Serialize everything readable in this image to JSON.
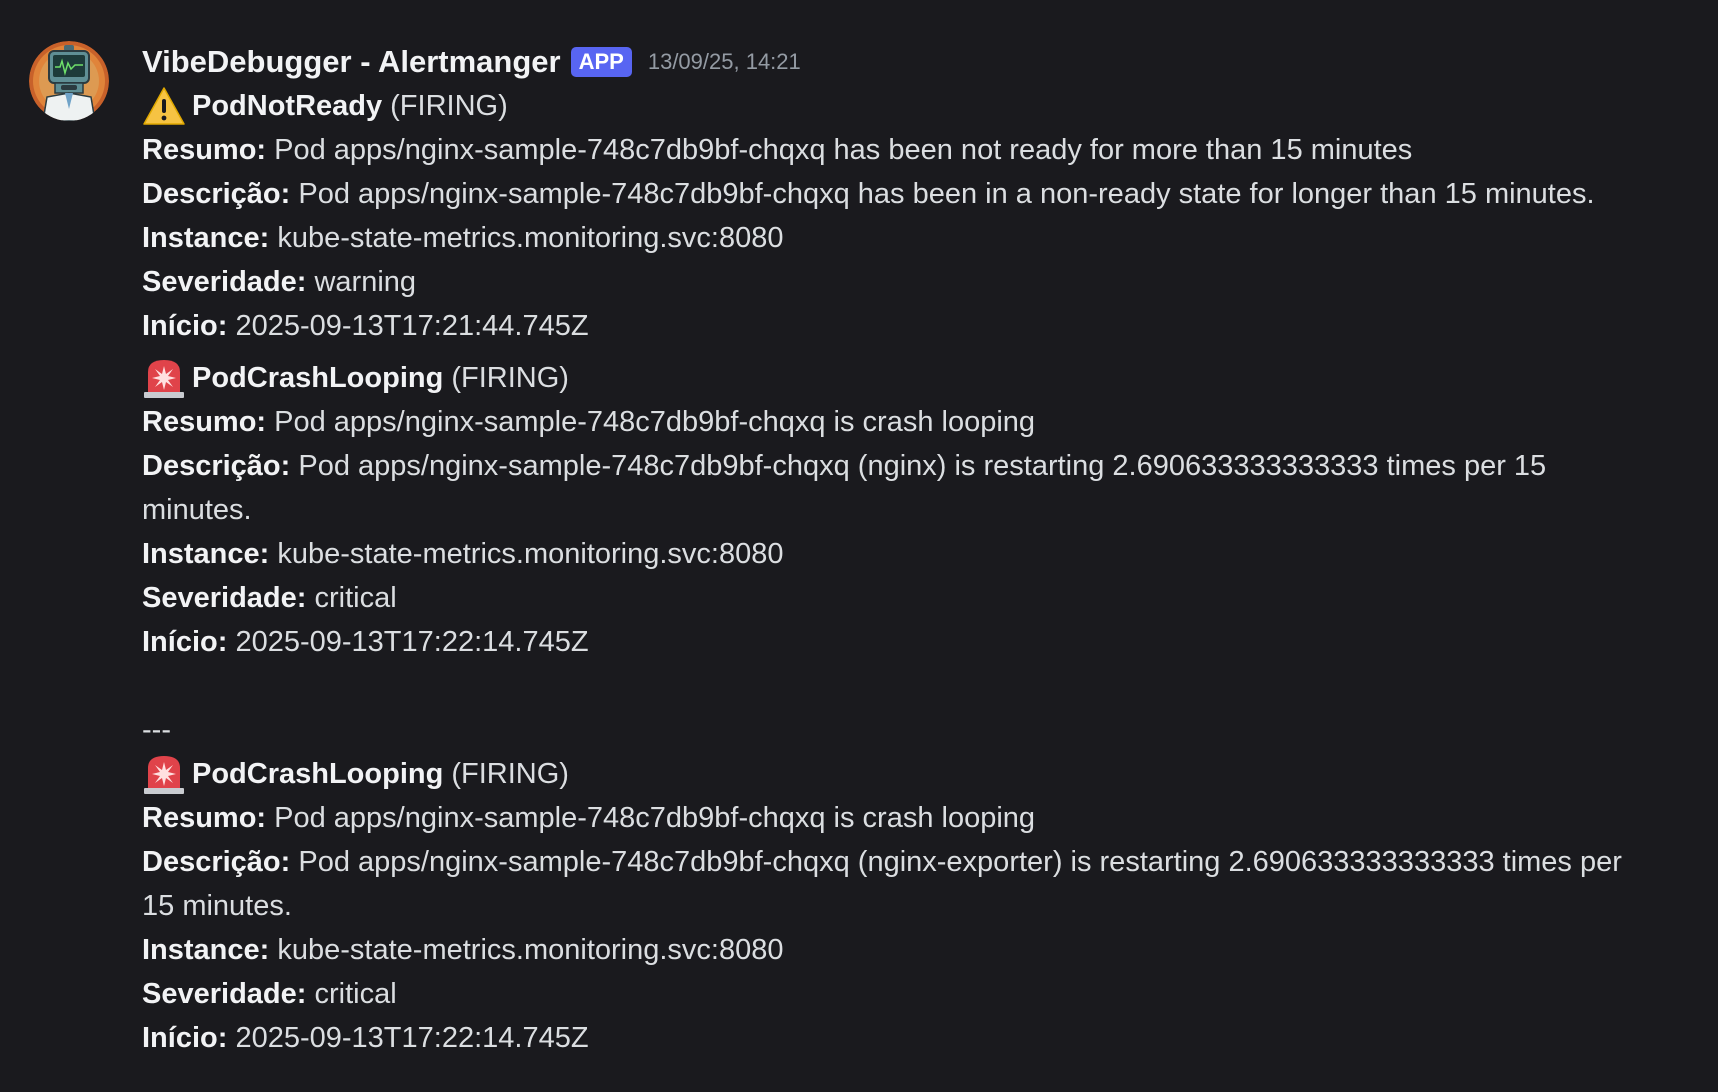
{
  "message": {
    "author": "VibeDebugger - Alertmanger",
    "app_tag": "APP",
    "timestamp": "13/09/25, 14:21",
    "avatar_icon": "robot-avatar-icon"
  },
  "alerts": [
    {
      "emoji": "warning-icon",
      "name": "PodNotReady",
      "state": "(FIRING)",
      "resumo_label": "Resumo:",
      "resumo": "Pod apps/nginx-sample-748c7db9bf-chqxq has been not ready for more than 15 minutes",
      "descricao_label": "Descrição:",
      "descricao": "Pod apps/nginx-sample-748c7db9bf-chqxq has been in a non-ready state for longer than 15 minutes.",
      "instance_label": "Instance:",
      "instance": "kube-state-metrics.monitoring.svc:8080",
      "severidade_label": "Severidade:",
      "severidade": "warning",
      "inicio_label": "Início:",
      "inicio": "2025-09-13T17:21:44.745Z"
    },
    {
      "emoji": "rotating-light-icon",
      "name": "PodCrashLooping",
      "state": "(FIRING)",
      "resumo_label": "Resumo:",
      "resumo": "Pod apps/nginx-sample-748c7db9bf-chqxq is crash looping",
      "descricao_label": "Descrição:",
      "descricao": "Pod apps/nginx-sample-748c7db9bf-chqxq (nginx) is restarting 2.690633333333333 times per 15 minutes.",
      "instance_label": "Instance:",
      "instance": "kube-state-metrics.monitoring.svc:8080",
      "severidade_label": "Severidade:",
      "severidade": "critical",
      "inicio_label": "Início:",
      "inicio": "2025-09-13T17:22:14.745Z"
    },
    {
      "emoji": "rotating-light-icon",
      "name": "PodCrashLooping",
      "state": "(FIRING)",
      "resumo_label": "Resumo:",
      "resumo": "Pod apps/nginx-sample-748c7db9bf-chqxq is crash looping",
      "descricao_label": "Descrição:",
      "descricao": "Pod apps/nginx-sample-748c7db9bf-chqxq (nginx-exporter) is restarting 2.690633333333333 times per 15 minutes.",
      "instance_label": "Instance:",
      "instance": "kube-state-metrics.monitoring.svc:8080",
      "severidade_label": "Severidade:",
      "severidade": "critical",
      "inicio_label": "Início:",
      "inicio": "2025-09-13T17:22:14.745Z"
    }
  ],
  "separator": "---",
  "colors": {
    "background": "#1a1a1e",
    "app_tag": "#5865f2",
    "text": "#dbdee1",
    "timestamp": "#949ba4"
  }
}
